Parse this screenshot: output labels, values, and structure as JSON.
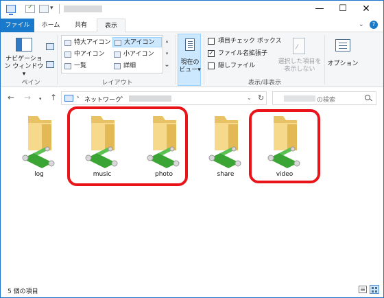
{
  "tabs": {
    "file": "ファイル",
    "home": "ホーム",
    "share": "共有",
    "view": "表示"
  },
  "ribbon": {
    "pane_group": {
      "navigation_pane_label": "ナビゲーション ウィンドウ▾",
      "group_label": "ペイン"
    },
    "layout_group": {
      "items": [
        "特大アイコン",
        "大アイコン",
        "中アイコン",
        "小アイコン",
        "一覧",
        "詳細"
      ],
      "selected": "大アイコン",
      "group_label": "レイアウト"
    },
    "current_view": {
      "sort_label": "現在の ビュー▾"
    },
    "show_hide_group": {
      "item_checkboxes_label": "項目チェック ボックス",
      "item_checkboxes_checked": false,
      "file_extensions_label": "ファイル名拡張子",
      "file_extensions_checked": true,
      "hidden_items_label": "隠しファイル",
      "hidden_items_checked": false,
      "hide_selected_label": "選択した項目を 表示しない",
      "group_label": "表示/非表示"
    },
    "options_label": "オプション"
  },
  "address": {
    "network_label": "ネットワーク",
    "search_placeholder_suffix": "の検索"
  },
  "items": [
    "log",
    "music",
    "photo",
    "share",
    "video"
  ],
  "highlighted_items": [
    "music",
    "photo",
    "video"
  ],
  "status": {
    "item_count_text": "5 個の項目"
  },
  "colors": {
    "accent": "#1979ca",
    "highlight": "#e8141a",
    "folder": "#f4d27a",
    "network_pipe": "#3aa534"
  }
}
